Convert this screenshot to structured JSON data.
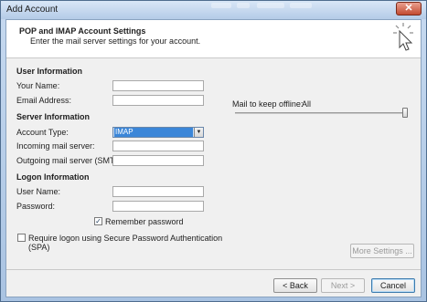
{
  "window": {
    "title": "Add Account",
    "close_glyph": "✕"
  },
  "header": {
    "title": "POP and IMAP Account Settings",
    "subtitle": "Enter the mail server settings for your account.",
    "icon": "wizard-cursor-icon"
  },
  "user_info": {
    "section_label": "User Information",
    "your_name_label": "Your Name:",
    "your_name_value": "",
    "email_label": "Email Address:",
    "email_value": ""
  },
  "server_info": {
    "section_label": "Server Information",
    "account_type_label": "Account Type:",
    "account_type_value": "IMAP",
    "incoming_label": "Incoming mail server:",
    "incoming_value": "",
    "outgoing_label": "Outgoing mail server (SMTP):",
    "outgoing_value": ""
  },
  "logon_info": {
    "section_label": "Logon Information",
    "username_label": "User Name:",
    "username_value": "",
    "password_label": "Password:",
    "password_value": "",
    "remember_label": "Remember password",
    "remember_checked": true,
    "remember_glyph": "✓",
    "spa_label_line1": "Require logon using Secure Password Authentication",
    "spa_label_line2": "(SPA)",
    "spa_checked": false
  },
  "offline": {
    "label": "Mail to keep offline:",
    "value": "All",
    "slider_fraction": 1.0
  },
  "buttons": {
    "more_settings": "More Settings ...",
    "back": "< Back",
    "next": "Next >",
    "cancel": "Cancel"
  },
  "colors": {
    "select_highlight": "#3b86d8",
    "title_bar": "#b4cbe7",
    "close_button": "#c24a30"
  }
}
